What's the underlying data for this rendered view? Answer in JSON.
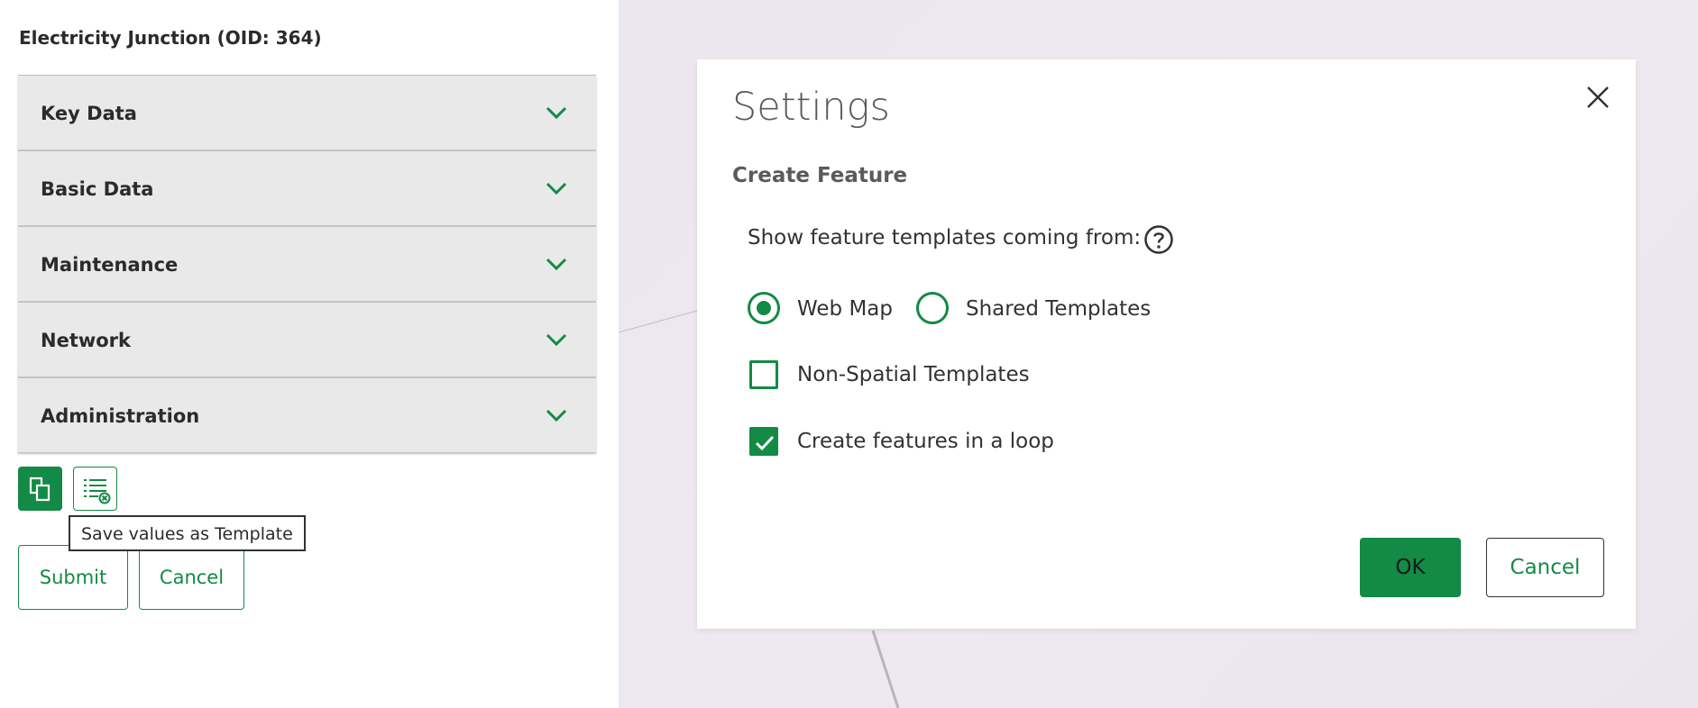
{
  "feature": {
    "title": "Electricity Junction (OID: 364)"
  },
  "accordion": {
    "items": [
      {
        "label": "Key Data",
        "icon": "chevron-down-icon"
      },
      {
        "label": "Basic Data",
        "icon": "chevron-down-icon"
      },
      {
        "label": "Maintenance",
        "icon": "chevron-down-icon"
      },
      {
        "label": "Network",
        "icon": "chevron-down-icon"
      },
      {
        "label": "Administration",
        "icon": "chevron-down-icon"
      }
    ]
  },
  "toolbar": {
    "copy_icon": "copy-icon",
    "template_icon": "list-settings-icon",
    "tooltip": "Save values as Template"
  },
  "form_actions": {
    "submit_label": "Submit",
    "cancel_label": "Cancel"
  },
  "dialog": {
    "title": "Settings",
    "section_title": "Create Feature",
    "templates_label": "Show feature templates coming from:",
    "help_icon": "question-circle-icon",
    "close_icon": "close-icon",
    "radio_options": [
      {
        "label": "Web Map",
        "checked": true
      },
      {
        "label": "Shared Templates",
        "checked": false
      }
    ],
    "checkboxes": [
      {
        "label": "Non-Spatial Templates",
        "checked": false
      },
      {
        "label": "Create features in a loop",
        "checked": true
      }
    ],
    "ok_label": "OK",
    "cancel_label": "Cancel"
  },
  "colors": {
    "accent": "#138a45",
    "panel_bg": "#e9e9e9",
    "map_bg": "#ece6ef"
  }
}
